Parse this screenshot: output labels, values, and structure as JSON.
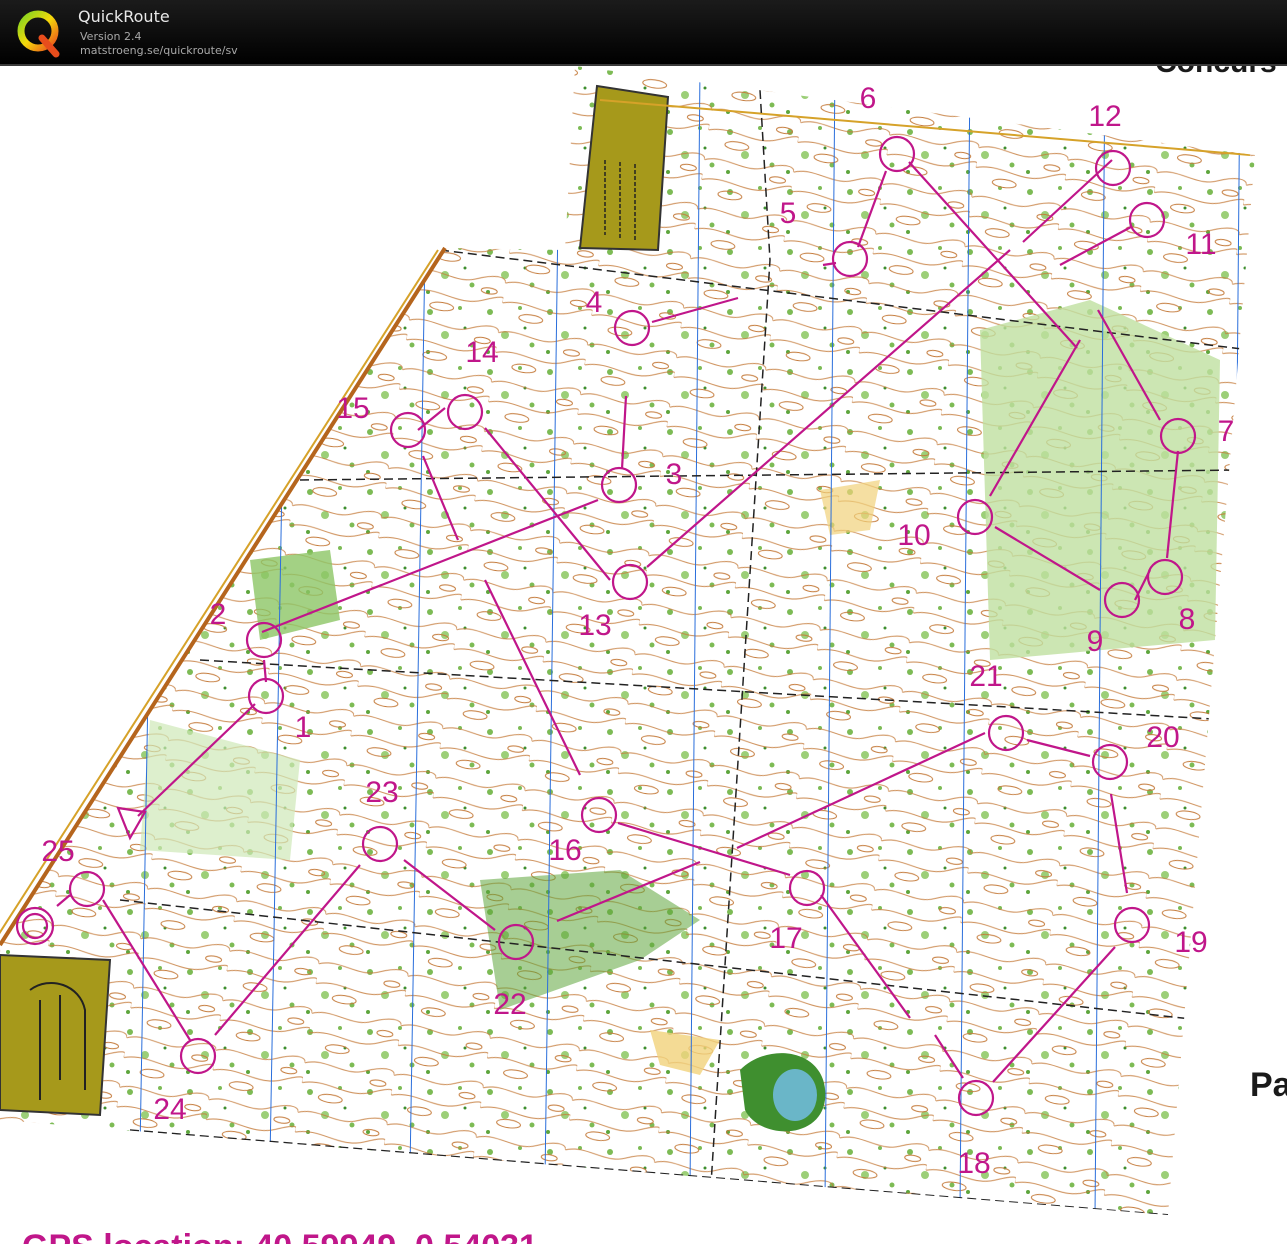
{
  "app": {
    "title": "QuickRoute",
    "version": "Version 2.4",
    "url": "matstroeng.se/quickroute/sv",
    "logo_letter": "Q"
  },
  "map": {
    "side_text_top": "Concurs",
    "side_text_right": "Pa",
    "bottom_text": "GPS location: 40.59949, 0.54031",
    "colors": {
      "course": "#c0168a",
      "terrain_open": "#ffffff",
      "vegetation": "#7dbb55",
      "vegetation_dark": "#3f8f2f",
      "contour": "#b5651d",
      "magnetic_north_lines": "#2a6edb",
      "out_of_bounds": "#a6991b"
    },
    "controls": [
      {
        "label": "1"
      },
      {
        "label": "2"
      },
      {
        "label": "3"
      },
      {
        "label": "4"
      },
      {
        "label": "5"
      },
      {
        "label": "6"
      },
      {
        "label": "7"
      },
      {
        "label": "8"
      },
      {
        "label": "9"
      },
      {
        "label": "10"
      },
      {
        "label": "11"
      },
      {
        "label": "12"
      },
      {
        "label": "13"
      },
      {
        "label": "14"
      },
      {
        "label": "15"
      },
      {
        "label": "16"
      },
      {
        "label": "17"
      },
      {
        "label": "18"
      },
      {
        "label": "19"
      },
      {
        "label": "20"
      },
      {
        "label": "21"
      },
      {
        "label": "22"
      },
      {
        "label": "23"
      },
      {
        "label": "24"
      },
      {
        "label": "25"
      }
    ]
  }
}
